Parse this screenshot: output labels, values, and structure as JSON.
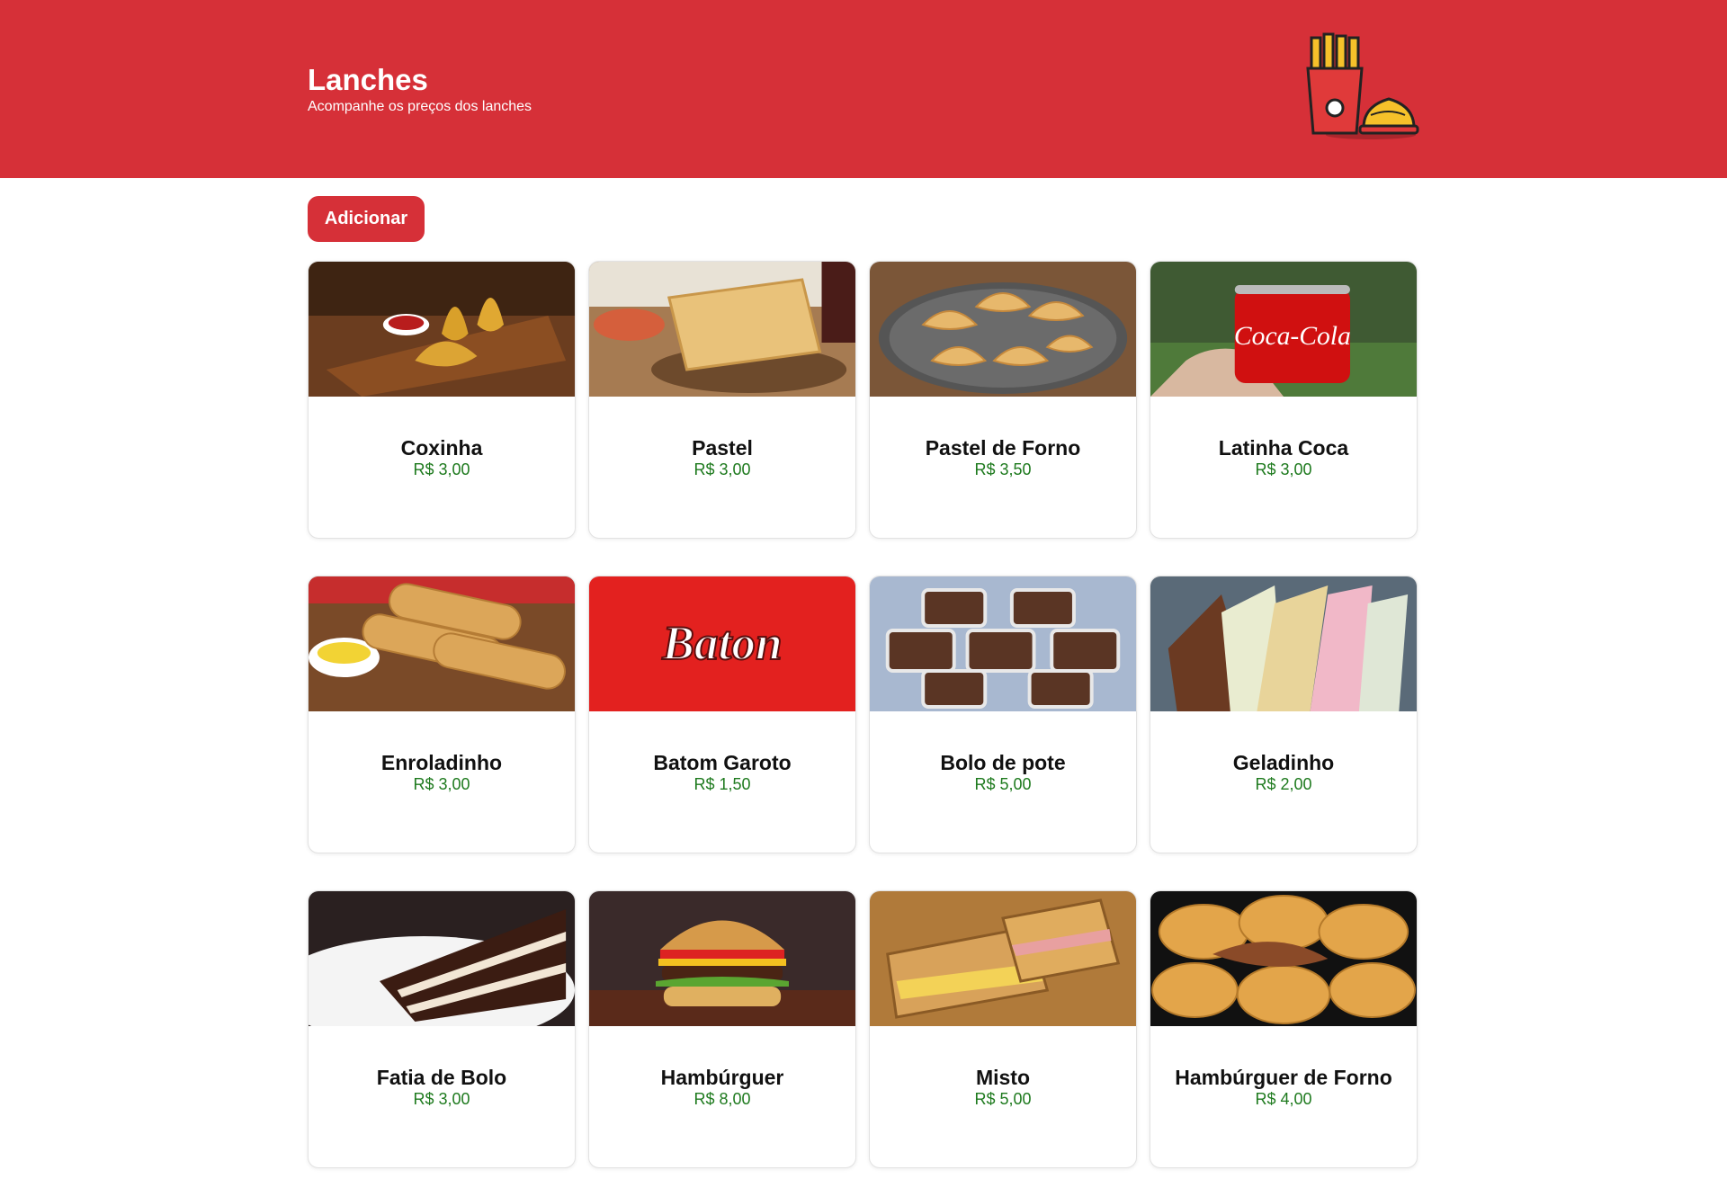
{
  "header": {
    "title": "Lanches",
    "subtitle": "Acompanhe os preços dos lanches",
    "logo_icon": "fries-and-snack-icon",
    "background": "#d63038"
  },
  "actions": {
    "add_label": "Adicionar"
  },
  "colors": {
    "accent": "#d63038",
    "price": "#1e7a1e"
  },
  "products": [
    {
      "name": "Coxinha",
      "price": "R$ 3,00",
      "image": "coxinha-image"
    },
    {
      "name": "Pastel",
      "price": "R$ 3,00",
      "image": "pastel-image"
    },
    {
      "name": "Pastel de Forno",
      "price": "R$ 3,50",
      "image": "pastel-de-forno-image"
    },
    {
      "name": "Latinha Coca",
      "price": "R$ 3,00",
      "image": "latinha-coca-image",
      "image_text": "Coca-Cola"
    },
    {
      "name": "Enroladinho",
      "price": "R$ 3,00",
      "image": "enroladinho-image"
    },
    {
      "name": "Batom Garoto",
      "price": "R$ 1,50",
      "image": "batom-garoto-image",
      "image_text": "Baton"
    },
    {
      "name": "Bolo de pote",
      "price": "R$ 5,00",
      "image": "bolo-de-pote-image"
    },
    {
      "name": "Geladinho",
      "price": "R$ 2,00",
      "image": "geladinho-image"
    },
    {
      "name": "Fatia de Bolo",
      "price": "R$ 3,00",
      "image": "fatia-de-bolo-image"
    },
    {
      "name": "Hambúrguer",
      "price": "R$ 8,00",
      "image": "hamburguer-image"
    },
    {
      "name": "Misto",
      "price": "R$ 5,00",
      "image": "misto-image"
    },
    {
      "name": "Hambúrguer de Forno",
      "price": "R$ 4,00",
      "image": "hamburguer-de-forno-image"
    }
  ]
}
